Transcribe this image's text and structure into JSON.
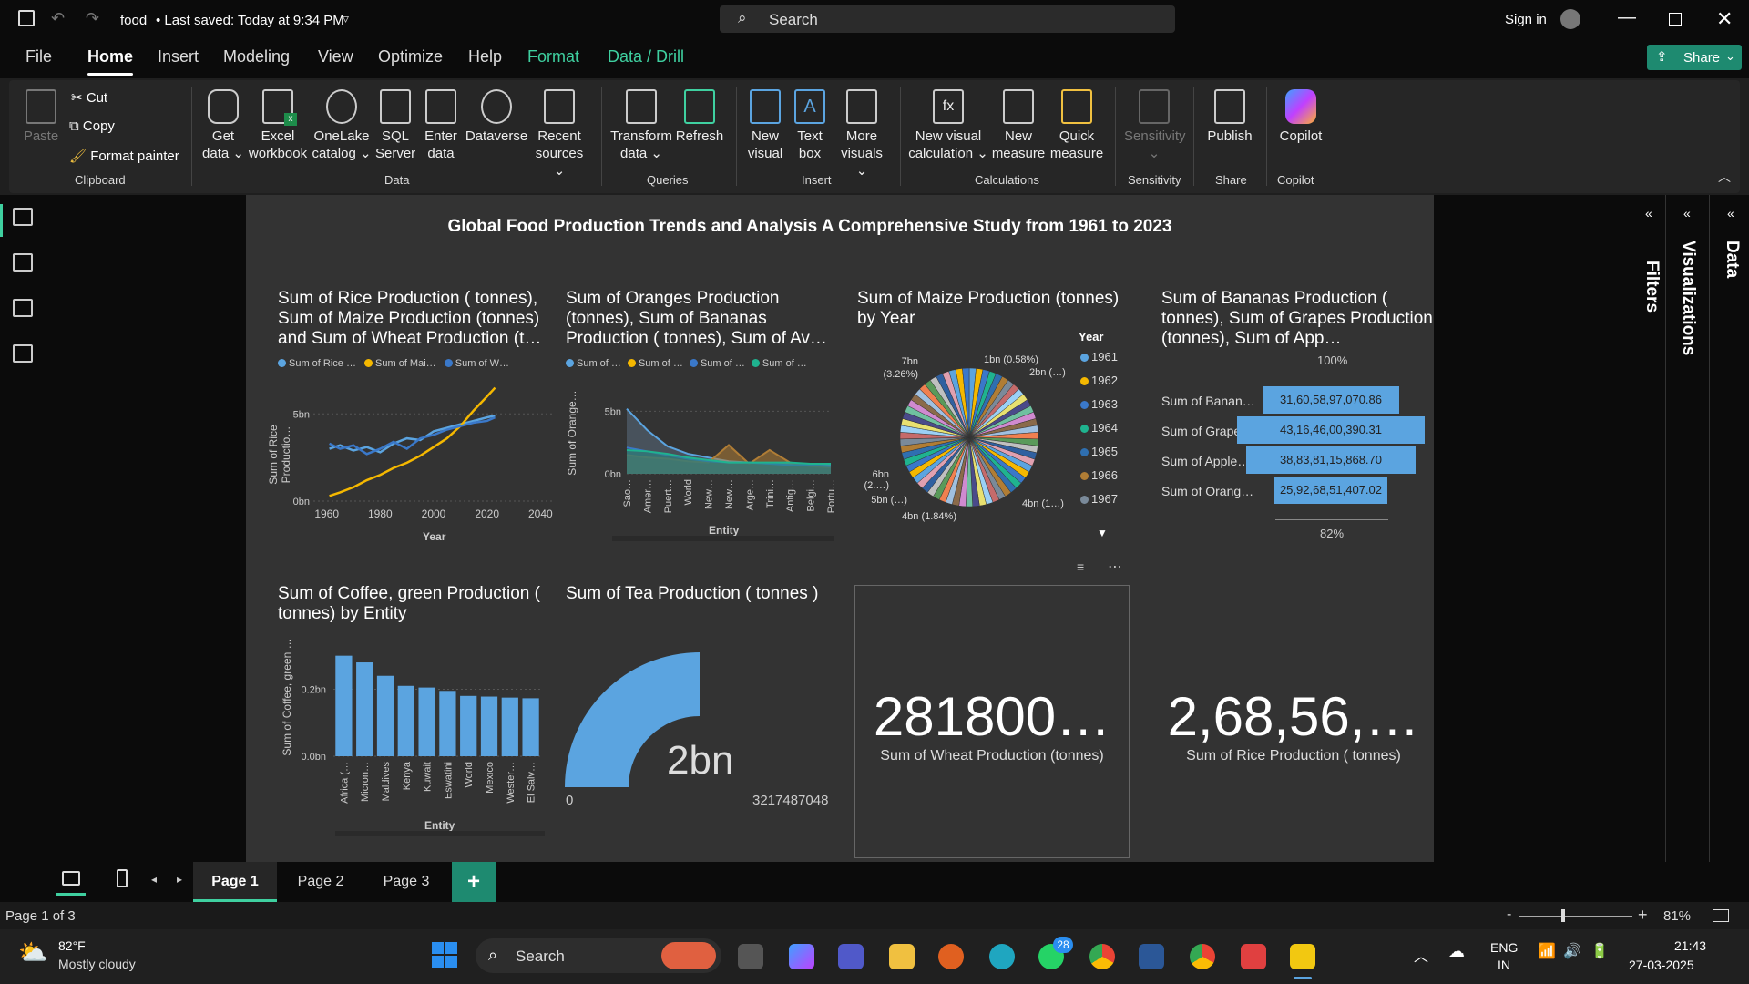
{
  "titlebar": {
    "doc": "food",
    "saved": "• Last saved: Today at 9:34 PM",
    "search": "Search",
    "signin": "Sign in"
  },
  "menu": {
    "tabs": [
      "File",
      "Home",
      "Insert",
      "Modeling",
      "View",
      "Optimize",
      "Help",
      "Format",
      "Data / Drill"
    ],
    "share": "Share"
  },
  "ribbon": {
    "paste": "Paste",
    "cut": "Cut",
    "copy": "Copy",
    "format_painter": "Format painter",
    "clipboard": "Clipboard",
    "get_data": "Get data ⌄",
    "excel": "Excel workbook",
    "onelake": "OneLake catalog ⌄",
    "sql": "SQL Server",
    "enter_data": "Enter data",
    "dataverse": "Dataverse",
    "recent": "Recent sources ⌄",
    "data_group": "Data",
    "transform": "Transform data ⌄",
    "refresh": "Refresh",
    "queries": "Queries",
    "new_visual": "New visual",
    "text_box": "Text box",
    "more_visuals": "More visuals ⌄",
    "insert": "Insert",
    "new_visual_calc": "New visual calculation ⌄",
    "new_measure": "New measure",
    "quick_measure": "Quick measure",
    "calculations": "Calculations",
    "sensitivity": "Sensitivity ⌄",
    "sensitivity_group": "Sensitivity",
    "publish": "Publish",
    "share_group": "Share",
    "copilot": "Copilot",
    "copilot_group": "Copilot"
  },
  "report": {
    "title": "Global Food Production Trends and Analysis A Comprehensive Study from 1961 to 2023",
    "v1": {
      "title": "Sum of Rice Production ( tonnes), Sum of Maize Production (tonnes) and Sum of Wheat Production (t…",
      "legend": [
        "Sum of Rice …",
        "Sum of Mai…",
        "Sum of W…"
      ],
      "ylabel": "Sum of Rice Productio…",
      "xlabel": "Year"
    },
    "v2": {
      "title": "Sum of Oranges Production (tonnes), Sum of Bananas Production ( tonnes), Sum of Av…",
      "legend": [
        "Sum of …",
        "Sum of …",
        "Sum of …",
        "Sum of …"
      ],
      "ylabel": "Sum of Orange…",
      "xlabel": "Entity"
    },
    "v3": {
      "title": "Sum of Maize Production (tonnes) by Year",
      "legend_title": "Year",
      "years": [
        "1961",
        "1962",
        "1963",
        "1964",
        "1965",
        "1966",
        "1967"
      ],
      "labels": [
        "7bn (3.26%)",
        "1bn (0.58%)",
        "2bn (…)",
        "6bn (2.…)",
        "5bn (…)",
        "4bn (1.84%)",
        "4bn (1…)"
      ]
    },
    "v4": {
      "title": "Sum of Bananas Production ( tonnes), Sum of Grapes Production (tonnes), Sum of App…",
      "top": "100%",
      "bottom": "82%"
    },
    "v5": {
      "title": "Sum of Coffee, green Production ( tonnes) by Entity",
      "ylabel": "Sum of Coffee, green …",
      "xlabel": "Entity"
    },
    "v6": {
      "title": "Sum of Tea Production ( tonnes )",
      "value": "2bn",
      "min": "0",
      "max": "3217487048"
    },
    "card1": {
      "value": "281800…",
      "label": "Sum of Wheat Production (tonnes)"
    },
    "card2": {
      "value": "2,68,56,…",
      "label": "Sum of Rice  Production ( tonnes)"
    }
  },
  "panes": {
    "filters": "Filters",
    "visualizations": "Visualizations",
    "data": "Data"
  },
  "pages": {
    "p1": "Page 1",
    "p2": "Page 2",
    "p3": "Page 3",
    "add": "+"
  },
  "status": {
    "page": "Page 1 of 3",
    "zoom": "81%",
    "minus": "-",
    "plus": "+"
  },
  "taskbar": {
    "temp": "82°F",
    "weather": "Mostly cloudy",
    "search": "Search",
    "lang1": "ENG",
    "lang2": "IN",
    "time": "21:43",
    "date": "27-03-2025",
    "badge": "28"
  },
  "colors": {
    "blue": "#5ba4e0",
    "yellow": "#f5b800",
    "darkblue": "#3a78c9",
    "teal": "#1fb38f",
    "brown": "#b07d35",
    "accent": "#1e8a70"
  },
  "chart_data": [
    {
      "type": "line",
      "title": "Sum of Rice Production ( tonnes), Sum of Maize Production (tonnes) and Sum of Wheat Production (t…",
      "xlabel": "Year",
      "ylabel": "Sum of Rice Productio…",
      "xlim": [
        1955,
        2045
      ],
      "ylim": [
        0,
        7
      ],
      "x_ticks": [
        "1960",
        "1980",
        "2000",
        "2020",
        "2040"
      ],
      "y_ticks": [
        "0bn",
        "5bn"
      ],
      "x": [
        1961,
        1965,
        1970,
        1975,
        1980,
        1985,
        1990,
        1995,
        2000,
        2005,
        2010,
        2015,
        2020,
        2023
      ],
      "series": [
        {
          "name": "Sum of Rice …",
          "values": [
            3.0,
            3.2,
            2.9,
            3.1,
            2.8,
            3.3,
            3.6,
            3.5,
            4.0,
            4.2,
            4.4,
            4.6,
            4.8,
            4.9
          ]
        },
        {
          "name": "Sum of Mai…",
          "values": [
            0.3,
            0.5,
            0.8,
            1.2,
            1.5,
            1.9,
            2.2,
            2.6,
            3.1,
            3.6,
            4.3,
            5.2,
            6.0,
            6.5
          ]
        },
        {
          "name": "Sum of W…",
          "values": [
            3.3,
            3.0,
            3.2,
            2.7,
            3.0,
            3.4,
            3.0,
            3.6,
            3.8,
            4.1,
            4.3,
            4.5,
            4.6,
            4.8
          ]
        }
      ]
    },
    {
      "type": "area",
      "xlabel": "Entity",
      "ylabel": "Sum of Orange…",
      "y_ticks": [
        "0bn",
        "5bn"
      ],
      "ylim": [
        0,
        7
      ],
      "categories": [
        "Sao…",
        "Amer…",
        "Puert…",
        "World",
        "New…",
        "New…",
        "Arge…",
        "Trini…",
        "Antig…",
        "Belgi…",
        "Portu…"
      ],
      "series": [
        {
          "name": "Sum of …",
          "values": [
            5.2,
            3.5,
            2.2,
            1.6,
            1.3,
            1.0,
            0.9,
            0.8,
            0.8,
            0.7,
            0.7
          ]
        },
        {
          "name": "Sum of …",
          "values": [
            1.5,
            1.3,
            1.2,
            1.0,
            0.9,
            2.3,
            0.8,
            1.9,
            0.9,
            0.6,
            0.5
          ]
        },
        {
          "name": "Sum of …",
          "values": [
            2.1,
            1.8,
            1.5,
            1.2,
            1.0,
            0.9,
            0.9,
            0.8,
            0.7,
            0.7,
            0.6
          ]
        },
        {
          "name": "Sum of …",
          "values": [
            1.9,
            1.8,
            1.6,
            1.3,
            1.1,
            0.9,
            0.9,
            0.9,
            0.9,
            0.8,
            0.8
          ]
        }
      ]
    },
    {
      "type": "pie",
      "title": "Sum of Maize Production (tonnes) by Year",
      "legend_title": "Year",
      "slices": 63,
      "labels": [
        "7bn (3.26%)",
        "1bn (0.58%)",
        "2bn (…)",
        "6bn (2.…)",
        "5bn (…)",
        "4bn (1.84%)",
        "4bn (1…)"
      ]
    },
    {
      "type": "bar",
      "title": "Sum of Bananas Production ( tonnes), Sum of Grapes Production (tonnes), Sum of App…",
      "categories": [
        "Sum of Banan…",
        "Sum of Grape…",
        "Sum of Apple…",
        "Sum of Orang…"
      ],
      "values": [
        3160589707086,
        4316460039031,
        3883811586870,
        2592681140702
      ],
      "value_labels": [
        "31,60,58,97,070.86",
        "43,16,46,00,390.31",
        "38,83,81,15,868.70",
        "25,92,68,51,407.02"
      ],
      "top_label": "100%",
      "bottom_label": "82%"
    },
    {
      "type": "bar",
      "title": "Sum of Coffee, green Production ( tonnes) by Entity",
      "xlabel": "Entity",
      "ylabel": "Sum of Coffee, green …",
      "y_ticks": [
        "0.0bn",
        "0.2bn"
      ],
      "ylim": [
        0,
        0.31
      ],
      "categories": [
        "Africa (…",
        "Micron…",
        "Maldives",
        "Kenya",
        "Kuwait",
        "Eswatini",
        "World",
        "Mexico",
        "Wester…",
        "El Salv…"
      ],
      "values": [
        0.3,
        0.28,
        0.24,
        0.21,
        0.205,
        0.195,
        0.18,
        0.178,
        0.175,
        0.173
      ]
    }
  ]
}
